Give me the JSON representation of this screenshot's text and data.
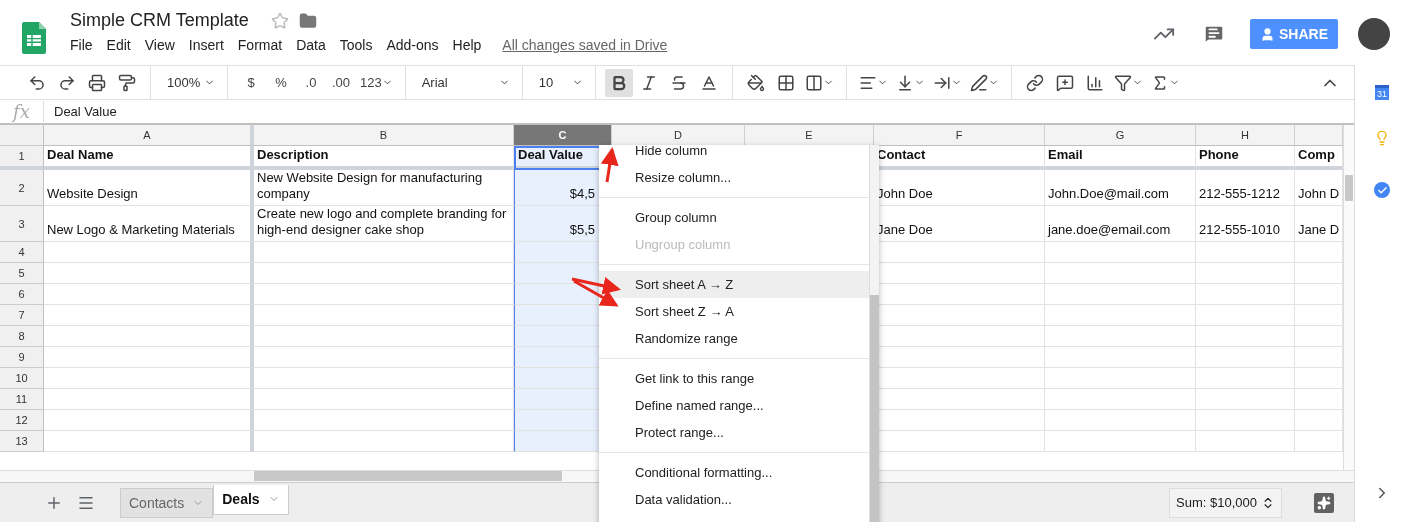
{
  "doc": {
    "title": "Simple CRM Template",
    "save_status": "All changes saved in Drive"
  },
  "menu": [
    "File",
    "Edit",
    "View",
    "Insert",
    "Format",
    "Data",
    "Tools",
    "Add-ons",
    "Help"
  ],
  "share": "SHARE",
  "toolbar": {
    "zoom": "100%",
    "currency": "$",
    "percent": "%",
    "decimals_less": ".0",
    "decimals_more": ".00",
    "formats": "123",
    "font": "Arial",
    "font_size": "10",
    "bold": true
  },
  "formula_bar": {
    "fx": "fx",
    "value": "Deal Value"
  },
  "columns": [
    {
      "label": "A",
      "selected": false
    },
    {
      "label": "B",
      "selected": false
    },
    {
      "label": "C",
      "selected": true,
      "numeric": true
    },
    {
      "label": "D",
      "selected": false
    },
    {
      "label": "E",
      "selected": false
    },
    {
      "label": "F",
      "selected": false
    },
    {
      "label": "G",
      "selected": false
    },
    {
      "label": "H",
      "selected": false
    },
    {
      "selected": false
    }
  ],
  "rows": [
    {
      "number": "1",
      "bold": true,
      "frozen": true,
      "cells": [
        "Deal Name",
        "Description",
        "Deal Value",
        null,
        null,
        "Contact",
        "Email",
        "Phone",
        "Comp"
      ]
    },
    {
      "number": "2",
      "bold": false,
      "frozen": false,
      "cells": [
        "Website Design",
        "New Website Design for manufacturing company",
        "$4,5",
        null,
        null,
        "John Doe",
        "John.Doe@mail.com",
        "212-555-1212",
        "John D"
      ]
    },
    {
      "number": "3",
      "bold": false,
      "frozen": false,
      "cells": [
        "New Logo & Marketing Materials",
        "Create new logo and complete branding for high-end designer cake shop",
        "$5,5",
        null,
        null,
        "Jane Doe",
        "jane.doe@email.com",
        "212-555-1010",
        "Jane D"
      ]
    },
    {
      "number": "4"
    },
    {
      "number": "5"
    },
    {
      "number": "6"
    },
    {
      "number": "7"
    },
    {
      "number": "8"
    },
    {
      "number": "9"
    },
    {
      "number": "10"
    },
    {
      "number": "11"
    },
    {
      "number": "12"
    },
    {
      "number": "13"
    }
  ],
  "context_menu": [
    [
      {
        "label": "Hide column",
        "disabled": false,
        "selected": false
      },
      {
        "label": "Resize column...",
        "disabled": false,
        "selected": false
      }
    ],
    [
      {
        "label": "Group column",
        "disabled": false,
        "selected": false
      },
      {
        "label": "Ungroup column",
        "disabled": true,
        "selected": false
      }
    ],
    [
      {
        "label": "Sort sheet A → Z",
        "disabled": false,
        "selected": true
      },
      {
        "label": "Sort sheet Z → A",
        "disabled": false,
        "selected": false
      },
      {
        "label": "Randomize range",
        "disabled": false,
        "selected": false
      }
    ],
    [
      {
        "label": "Get link to this range",
        "disabled": false,
        "selected": false
      },
      {
        "label": "Define named range...",
        "disabled": false,
        "selected": false
      },
      {
        "label": "Protect range...",
        "disabled": false,
        "selected": false
      }
    ],
    [
      {
        "label": "Conditional formatting...",
        "disabled": false,
        "selected": false
      },
      {
        "label": "Data validation...",
        "disabled": false,
        "selected": false
      }
    ]
  ],
  "sheets": [
    {
      "label": "Contacts",
      "selected": false
    },
    {
      "label": "Deals",
      "selected": true
    }
  ],
  "status": {
    "sum": "Sum: $10,000"
  },
  "side_panel": {
    "calendar_day": "31"
  }
}
